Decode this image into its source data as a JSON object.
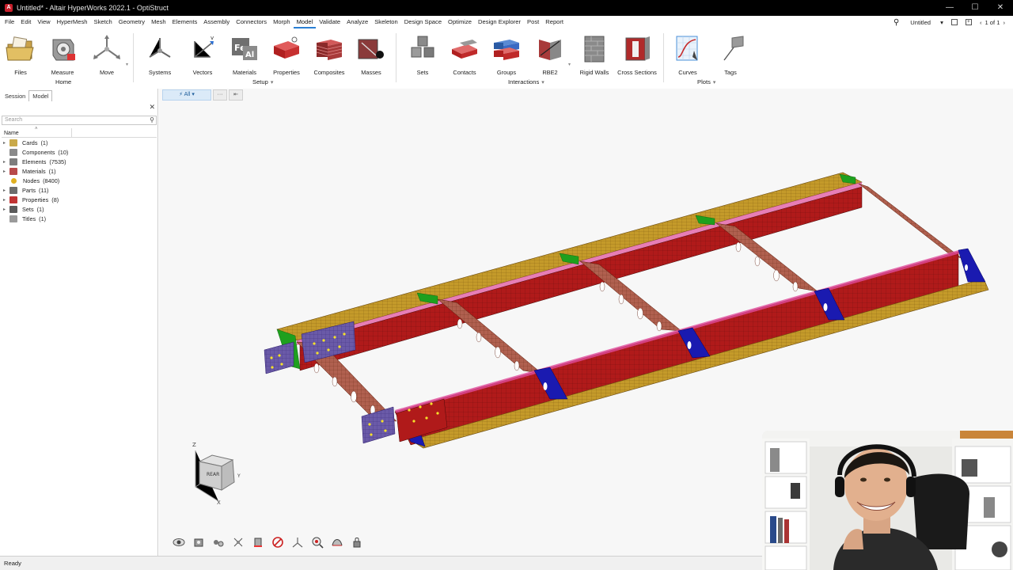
{
  "window": {
    "title": "Untitled* - Altair HyperWorks 2022.1 - OptiStruct",
    "controls": [
      "—",
      "☐",
      "✕"
    ]
  },
  "menu": {
    "items": [
      "File",
      "Edit",
      "View",
      "HyperMesh",
      "Sketch",
      "Geometry",
      "Mesh",
      "Elements",
      "Assembly",
      "Connectors",
      "Morph",
      "Model",
      "Validate",
      "Analyze",
      "Skeleton",
      "Design Space",
      "Optimize",
      "Design Explorer",
      "Post",
      "Report"
    ],
    "active": "Model",
    "right": {
      "session": "Untitled",
      "pages": "1 of 1"
    }
  },
  "ribbon": {
    "tools": {
      "files": "Files",
      "measure": "Measure",
      "move": "Move",
      "systems": "Systems",
      "vectors": "Vectors",
      "materials": "Materials",
      "properties": "Properties",
      "composites": "Composites",
      "masses": "Masses",
      "sets": "Sets",
      "contacts": "Contacts",
      "groups": "Groups",
      "rbe2": "RBE2",
      "rigid_walls": "Rigid Walls",
      "cross_sections": "Cross Sections",
      "curves": "Curves",
      "tags": "Tags"
    },
    "groups": {
      "home": "Home",
      "setup": "Setup",
      "interactions": "Interactions",
      "plots": "Plots"
    }
  },
  "browser": {
    "tabs": [
      "Session",
      "Model"
    ],
    "active_tab": "Model",
    "search_placeholder": "Search",
    "column_name": "Name",
    "items": [
      {
        "label": "Cards",
        "count": "(1)",
        "color": "#c9a94a",
        "expandable": true
      },
      {
        "label": "Components",
        "count": "(10)",
        "color": "#8a8a8a",
        "expandable": false
      },
      {
        "label": "Elements",
        "count": "(7535)",
        "color": "#7d7d7d",
        "expandable": true
      },
      {
        "label": "Materials",
        "count": "(1)",
        "color": "#b84a4a",
        "expandable": true
      },
      {
        "label": "Nodes",
        "count": "(8400)",
        "color": "#e0b020",
        "expandable": false
      },
      {
        "label": "Parts",
        "count": "(11)",
        "color": "#6d6d6d",
        "expandable": true
      },
      {
        "label": "Properties",
        "count": "(8)",
        "color": "#c03434",
        "expandable": true
      },
      {
        "label": "Sets",
        "count": "(1)",
        "color": "#5a5a5a",
        "expandable": true
      },
      {
        "label": "Titles",
        "count": "(1)",
        "color": "#9a9a9a",
        "expandable": false
      }
    ]
  },
  "viewport_toolbar": {
    "filter": "All",
    "more": "···"
  },
  "triad": {
    "z": "Z",
    "x": "X",
    "y": "Y",
    "cube_face": "REAR"
  },
  "status": {
    "text": "Ready"
  },
  "colors": {
    "rail_yellow": "#c8a12c",
    "beam_red": "#b01e1e",
    "mesh_pink": "#c06a5a",
    "gusset_blue": "#1a1ab0",
    "plate_purple": "#6a5aa8",
    "weld_green": "#1ea01e",
    "accent_blue": "#2a7fd4"
  }
}
